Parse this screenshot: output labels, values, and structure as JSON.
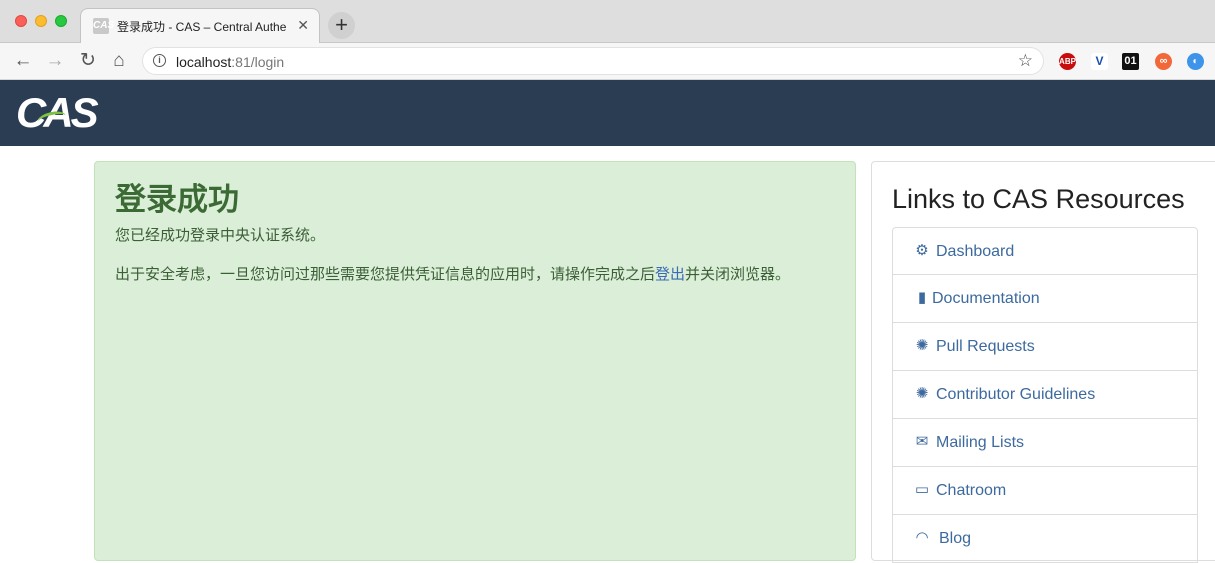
{
  "browser": {
    "tab_favicon": "CAS",
    "tab_title": "登录成功 - CAS – Central Authe",
    "url_host": "localhost",
    "url_rest": ":81/login",
    "extensions": [
      "ABP",
      "V",
      "01",
      "∞",
      "◐"
    ]
  },
  "header": {
    "logo": "CAS"
  },
  "main": {
    "title": "登录成功",
    "subtitle": "您已经成功登录中央认证系统。",
    "message_before": "出于安全考虑，一旦您访问过那些需要您提供凭证信息的应用时，请操作完成之后",
    "logout_link": "登出",
    "message_after": "并关闭浏览器。"
  },
  "resources": {
    "title": "Links to CAS Resources",
    "items": [
      {
        "icon": "cogs-icon",
        "label": "Dashboard"
      },
      {
        "icon": "file-icon",
        "label": "Documentation"
      },
      {
        "icon": "bug-icon",
        "label": "Pull Requests"
      },
      {
        "icon": "bug-icon",
        "label": "Contributor Guidelines"
      },
      {
        "icon": "envelope-icon",
        "label": "Mailing Lists"
      },
      {
        "icon": "comment-icon",
        "label": "Chatroom"
      },
      {
        "icon": "rss-icon",
        "label": "Blog"
      }
    ]
  }
}
